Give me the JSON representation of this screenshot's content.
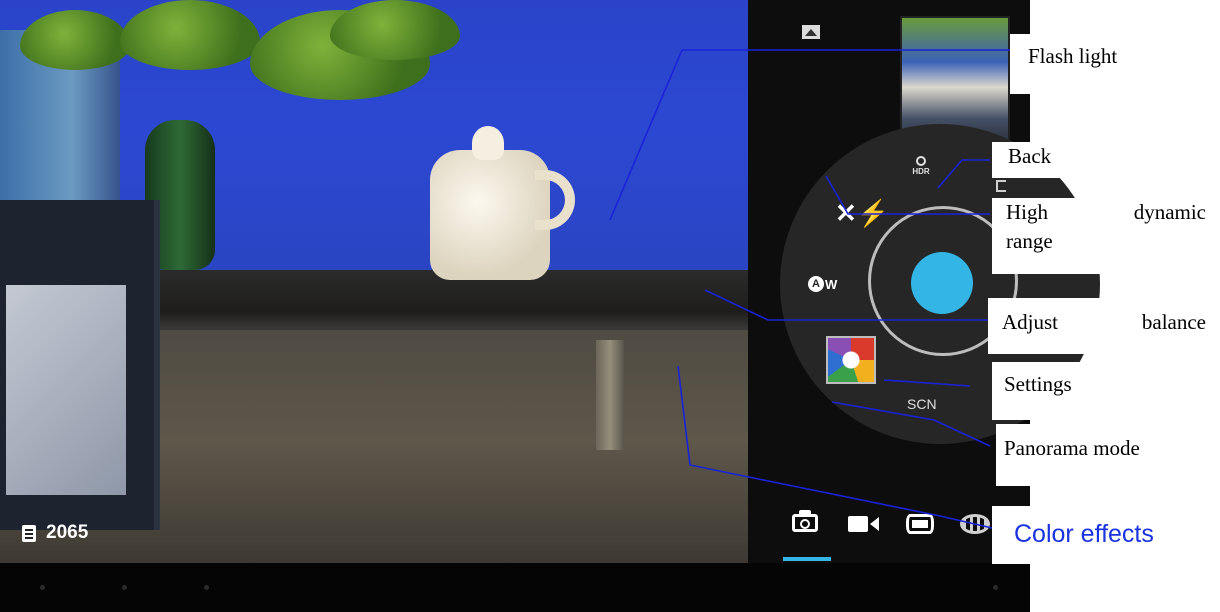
{
  "viewfinder": {
    "photo_counter": "2065",
    "storage_icon": "sd-card-icon"
  },
  "controls": {
    "gallery_icon": "gallery-icon",
    "hdr_icon_text": "HDR",
    "flash_icon": "flash-off-icon",
    "white_balance_text": "W",
    "white_balance_badge": "A",
    "scene_label": "SCN",
    "shutter_color": "#33b5e5"
  },
  "modes": [
    {
      "name": "camera-mode-icon",
      "selected": true
    },
    {
      "name": "video-mode-icon",
      "selected": false
    },
    {
      "name": "panorama-mode-icon",
      "selected": false
    },
    {
      "name": "photosphere-mode-icon",
      "selected": false
    }
  ],
  "callouts": {
    "flash_light": "Flash light",
    "back": "Back",
    "hdr_line1_a": "High",
    "hdr_line1_b": "dynamic",
    "hdr_line2": "range",
    "balance_a": "Adjust",
    "balance_b": "balance",
    "settings": "Settings",
    "panorama": "Panorama mode",
    "color_effects": "Color effects"
  },
  "colors": {
    "accent": "#33b5e5",
    "leader_line": "#1a22d8",
    "color_effects_text": "#1a33e0"
  }
}
